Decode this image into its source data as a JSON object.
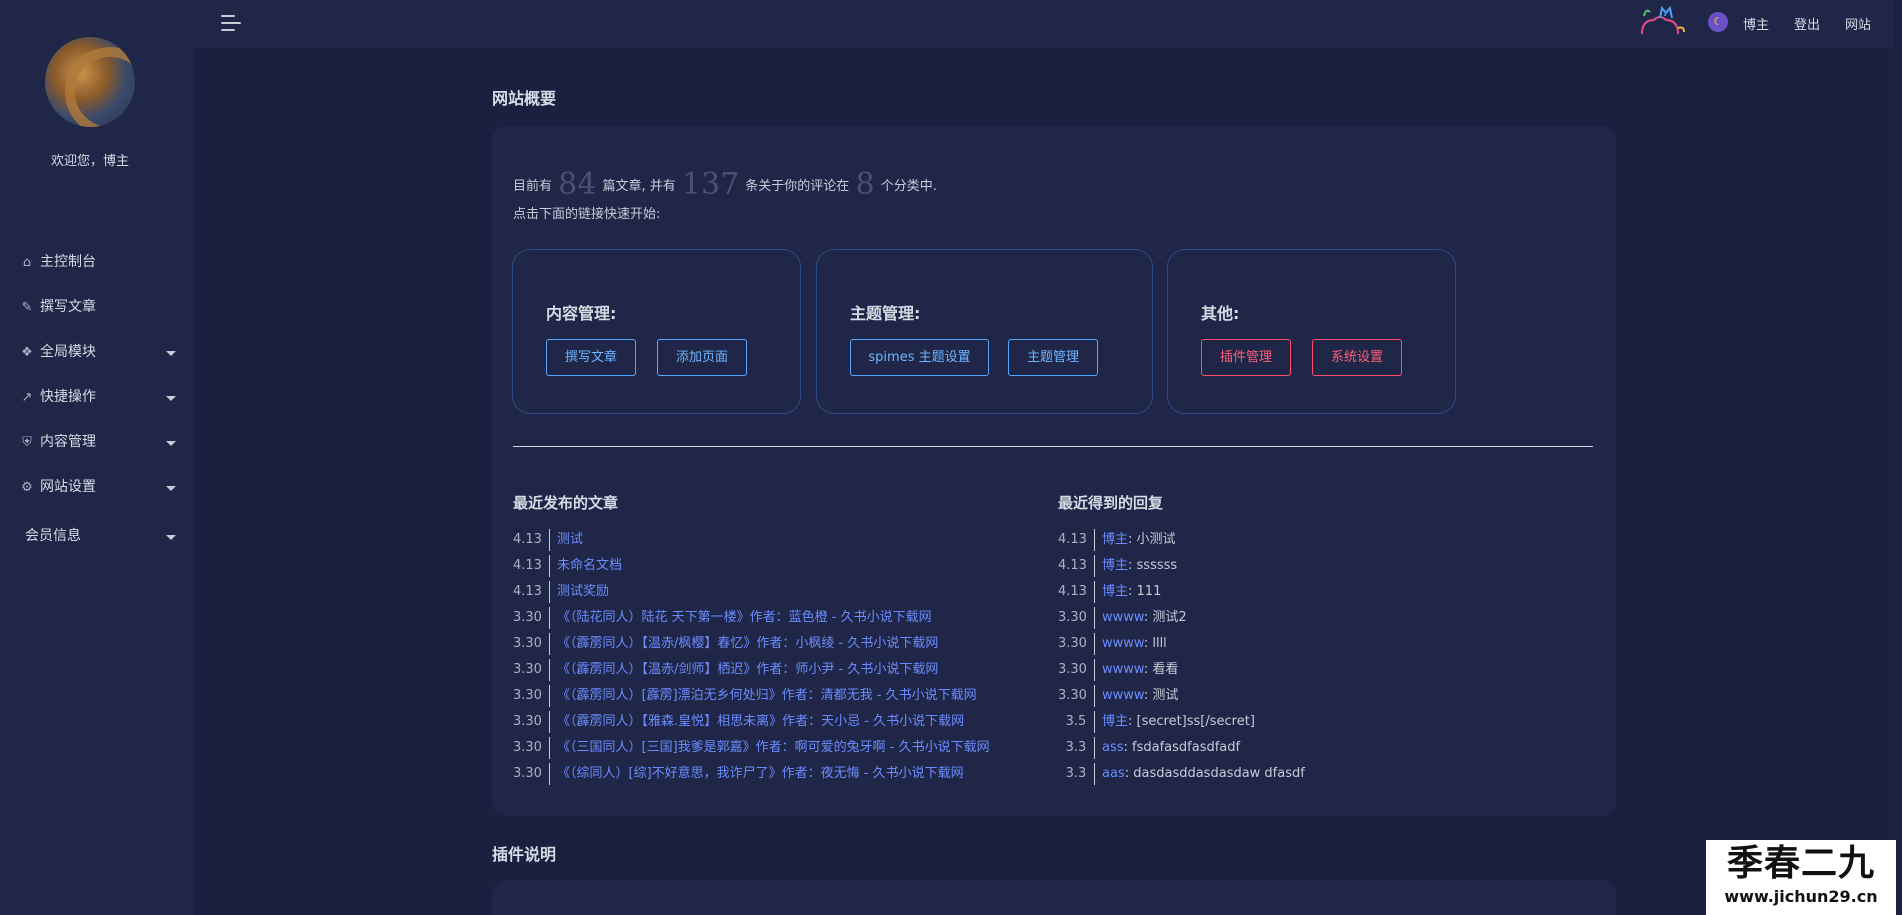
{
  "sidebar": {
    "welcome": "欢迎您，博主",
    "items": [
      {
        "label": "主控制台",
        "icon": "home-icon",
        "glyph": "⌂",
        "caret": false
      },
      {
        "label": "撰写文章",
        "icon": "edit-icon",
        "glyph": "✎",
        "caret": false
      },
      {
        "label": "全局模块",
        "icon": "modules-icon",
        "glyph": "❖",
        "caret": true
      },
      {
        "label": "快捷操作",
        "icon": "shortcut-icon",
        "glyph": "↗",
        "caret": true
      },
      {
        "label": "内容管理",
        "icon": "shield-icon",
        "glyph": "⛨",
        "caret": true
      },
      {
        "label": "网站设置",
        "icon": "gear-icon",
        "glyph": "⚙",
        "caret": true
      },
      {
        "label": "会员信息",
        "icon": "",
        "glyph": "",
        "caret": true
      }
    ]
  },
  "topbar": {
    "links": [
      "博主",
      "登出",
      "网站"
    ],
    "moon_icon": "moon-icon"
  },
  "overview": {
    "title": "网站概要",
    "summary_pre": "目前有",
    "posts": "84",
    "summary_mid1": "篇文章, 并有",
    "comments": "137",
    "summary_mid2": "条关于你的评论在",
    "categories": "8",
    "summary_post": "个分类中.",
    "hint": "点击下面的链接快速开始:"
  },
  "cards": {
    "content": {
      "title": "内容管理:",
      "buttons": [
        "撰写文章",
        "添加页面"
      ]
    },
    "theme": {
      "title": "主题管理:",
      "buttons": [
        "spimes 主题设置",
        "主题管理"
      ]
    },
    "other": {
      "title": "其他:",
      "buttons": [
        "插件管理",
        "系统设置"
      ]
    }
  },
  "recent_posts": {
    "title": "最近发布的文章",
    "items": [
      {
        "date": "4.13",
        "title": "测试"
      },
      {
        "date": "4.13",
        "title": "未命名文档"
      },
      {
        "date": "4.13",
        "title": "测试奖励"
      },
      {
        "date": "3.30",
        "title": "《（陆花同人）陆花 天下第一楼》作者：蓝色橙 - 久书小说下载网"
      },
      {
        "date": "3.30",
        "title": "《（霹雳同人）【温赤/枫樱】春忆》作者：小枫绫 - 久书小说下载网"
      },
      {
        "date": "3.30",
        "title": "《（霹雳同人）【温赤/剑师】栖迟》作者：师小尹 - 久书小说下载网"
      },
      {
        "date": "3.30",
        "title": "《（霹雳同人）[霹雳]漂泊无乡何处归》作者：清都无我 - 久书小说下载网"
      },
      {
        "date": "3.30",
        "title": "《（霹雳同人）【雅森.皇悦】相思未离》作者：天小忌 - 久书小说下载网"
      },
      {
        "date": "3.30",
        "title": "《（三国同人）[三国]我爹是郭嘉》作者：啊可爱的兔牙啊 - 久书小说下载网"
      },
      {
        "date": "3.30",
        "title": "《（综同人）[综]不好意思，我诈尸了》作者：夜无悔 - 久书小说下载网"
      }
    ]
  },
  "recent_replies": {
    "title": "最近得到的回复",
    "items": [
      {
        "date": "4.13",
        "author": "博主",
        "text": "小测试"
      },
      {
        "date": "4.13",
        "author": "博主",
        "text": "ssssss"
      },
      {
        "date": "4.13",
        "author": "博主",
        "text": "111"
      },
      {
        "date": "3.30",
        "author": "wwww",
        "text": "测试2"
      },
      {
        "date": "3.30",
        "author": "wwww",
        "text": "llll"
      },
      {
        "date": "3.30",
        "author": "wwww",
        "text": "看看"
      },
      {
        "date": "3.30",
        "author": "wwww",
        "text": "测试"
      },
      {
        "date": "3.5",
        "author": "博主",
        "text": "[secret]ss[/secret]"
      },
      {
        "date": "3.3",
        "author": "ass",
        "text": "fsdafasdfasdfadf"
      },
      {
        "date": "3.3",
        "author": "aas",
        "text": "dasdasddasdasdaw dfasdf"
      }
    ]
  },
  "plugins": {
    "title": "插件说明"
  },
  "watermark": {
    "text": "季春二九",
    "url": "www.jichun29.cn"
  },
  "colors": {
    "bg": "#1a2040",
    "panel": "#1f2647",
    "link": "#6b8cff",
    "btn_blue": "#55a8ff",
    "btn_red": "#ff4d6d"
  }
}
